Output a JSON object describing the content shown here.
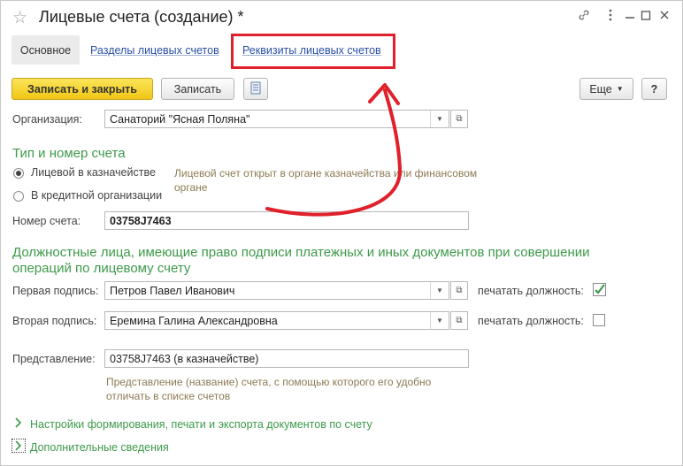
{
  "window": {
    "title": "Лицевые счета (создание) *",
    "controls": [
      "link-icon",
      "more-icon",
      "minimize-icon",
      "maximize-icon",
      "close-icon"
    ]
  },
  "tabs": [
    {
      "label": "Основное",
      "active": true
    },
    {
      "label": "Разделы лицевых счетов",
      "active": false
    },
    {
      "label": "Реквизиты лицевых счетов",
      "active": false,
      "highlighted": true
    }
  ],
  "toolbar": {
    "save_close": "Записать и закрыть",
    "save": "Записать",
    "more": "Еще",
    "help": "?"
  },
  "organization": {
    "label": "Организация:",
    "value": "Санаторий \"Ясная Поляна\""
  },
  "account_section": {
    "title": "Тип и номер счета",
    "options": [
      {
        "label": "Лицевой в казначействе",
        "selected": true
      },
      {
        "label": "В кредитной организации",
        "selected": false
      }
    ],
    "hint": "Лицевой счет открыт в органе казначейства или финансовом органе",
    "number_label": "Номер счета:",
    "number_value": "03758J7463"
  },
  "signers_section": {
    "title_line1": "Должностные лица, имеющие право подписи платежных и иных документов при совершении",
    "title_line2": "операций по лицевому счету",
    "first_label": "Первая подпись:",
    "first_value": "Петров Павел Иванович",
    "second_label": "Вторая подпись:",
    "second_value": "Еремина Галина Александровна",
    "print_label": "печатать должность:",
    "first_print": true,
    "second_print": false
  },
  "presentation": {
    "label": "Представление:",
    "value": "03758J7463 (в казначействе)",
    "hint_line1": "Представление (название) счета, с помощью которого его удобно",
    "hint_line2": "отличать в списке счетов"
  },
  "collapsibles": [
    {
      "label": "Настройки формирования, печати и экспорта документов по счету"
    },
    {
      "label": "Дополнительные сведения"
    }
  ],
  "colors": {
    "accent_green": "#3d9a4a",
    "link_blue": "#2a50a6",
    "annotation_red": "#e0202a",
    "primary_yellow": "#f5d125"
  }
}
